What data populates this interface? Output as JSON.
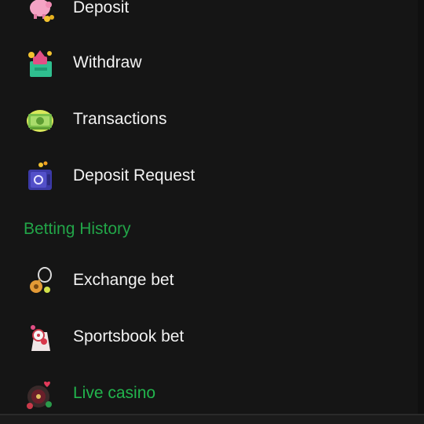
{
  "menu": {
    "wallet_items": [
      {
        "label": "Deposit",
        "icon": "piggy-bank-icon"
      },
      {
        "label": "Withdraw",
        "icon": "money-bag-icon"
      },
      {
        "label": "Transactions",
        "icon": "cash-stack-icon"
      },
      {
        "label": "Deposit Request",
        "icon": "safe-box-icon"
      }
    ],
    "betting_history": {
      "heading": "Betting History",
      "items": [
        {
          "label": "Exchange bet",
          "icon": "tennis-trophy-icon"
        },
        {
          "label": "Sportsbook bet",
          "icon": "sports-ball-icon"
        },
        {
          "label": "Live casino",
          "icon": "roulette-chips-icon"
        }
      ]
    }
  },
  "colors": {
    "background": "#151515",
    "text": "#f2f2f2",
    "accent_green": "#22b54d"
  }
}
